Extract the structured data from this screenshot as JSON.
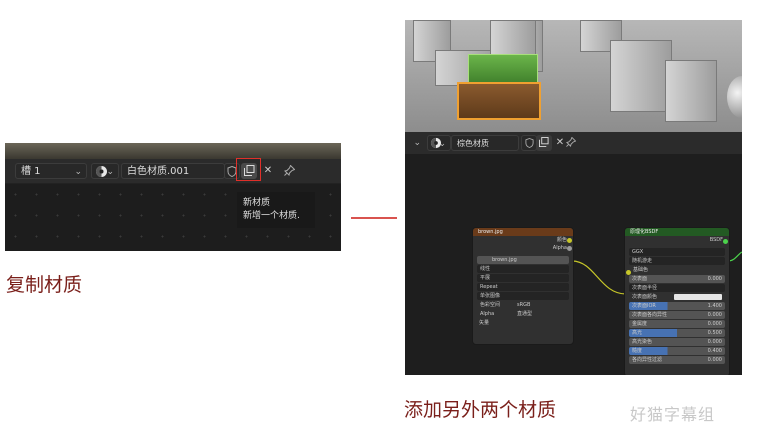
{
  "left_panel": {
    "slot_label": "槽 1",
    "material_name": "白色材质.001",
    "tooltip_title": "新材质",
    "tooltip_desc": "新增一个材质."
  },
  "left_caption": "复制材质",
  "right_panel": {
    "material_name": "棕色材质",
    "image_node": {
      "header": "brown.jpg",
      "out_color": "颜色",
      "out_alpha": "Alpha",
      "image_field": "brown.jpg",
      "interp": "线性",
      "projection": "平展",
      "extension": "Repeat",
      "source": "单张图像",
      "colorspace_label": "色彩空间",
      "colorspace_value": "sRGB",
      "alpha_label": "Alpha",
      "alpha_value": "直通型",
      "vector": "矢量"
    },
    "bsdf_node": {
      "header": "原理化BSDF",
      "out_bsdf": "BSDF",
      "method": "GGX",
      "subsurface_method": "随机游走",
      "base_color": "基础色",
      "subsurface": "次表面",
      "subsurface_value": "0.000",
      "subsurface_radius": "次表面半径",
      "subsurface_color": "次表面颜色",
      "subsurface_ior": "次表面IOR",
      "subsurface_ior_value": "1.400",
      "anisotropy": "次表面各向异性",
      "anisotropy_value": "0.000",
      "metallic": "金属度",
      "metallic_value": "0.000",
      "specular": "高光",
      "specular_value": "0.500",
      "specular_tint": "高光染色",
      "specular_tint_value": "0.000",
      "roughness": "糙度",
      "roughness_value": "0.400",
      "aniso2": "各向异性过滤",
      "aniso2_value": "0.000"
    }
  },
  "right_caption": "添加另外两个材质",
  "watermark": "好猫字幕组",
  "colors": {
    "accent_red": "#d9534f",
    "caption": "#7a1f1a",
    "image_node_header": "#6a3b1a",
    "bsdf_node_header": "#235a23",
    "slider_blue": "#4772b3"
  }
}
